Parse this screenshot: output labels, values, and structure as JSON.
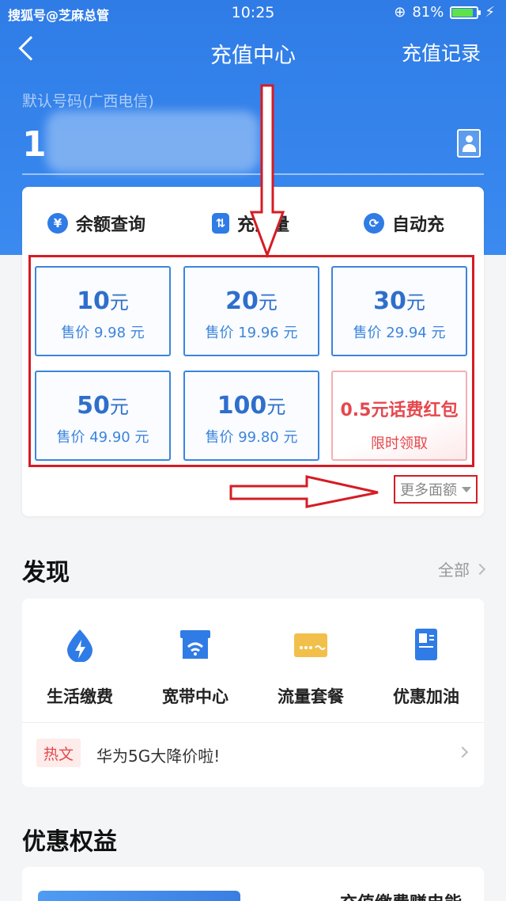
{
  "status_bar": {
    "watermark": "搜狐号@芝麻总管",
    "time": "10:25",
    "battery": "81%",
    "battery_level": 0.81
  },
  "nav": {
    "title": "充值中心",
    "records_label": "充值记录"
  },
  "phone": {
    "label": "默认号码(广西电信)",
    "number_visible": "1"
  },
  "quick_actions": [
    {
      "label": "余额查询",
      "icon": "yuan-search-icon"
    },
    {
      "label": "充流量",
      "icon": "data-flow-icon"
    },
    {
      "label": "自动充",
      "icon": "refresh-icon"
    }
  ],
  "tiles": [
    {
      "amount": "10",
      "unit": "元",
      "price": "售价 9.98 元"
    },
    {
      "amount": "20",
      "unit": "元",
      "price": "售价 19.96 元"
    },
    {
      "amount": "30",
      "unit": "元",
      "price": "售价 29.94 元"
    },
    {
      "amount": "50",
      "unit": "元",
      "price": "售价 49.90 元"
    },
    {
      "amount": "100",
      "unit": "元",
      "price": "售价 99.80 元"
    }
  ],
  "promo_tile": {
    "title": "0.5元话费红包",
    "subtitle": "限时领取"
  },
  "more_amounts_label": "更多面额",
  "discover": {
    "title": "发现",
    "see_all": "全部",
    "items": [
      {
        "label": "生活缴费",
        "icon": "water-drop-icon"
      },
      {
        "label": "宽带中心",
        "icon": "wifi-store-icon"
      },
      {
        "label": "流量套餐",
        "icon": "card-icon"
      },
      {
        "label": "优惠加油",
        "icon": "fuel-pump-icon"
      }
    ],
    "hot_tag": "热文",
    "hot_text": "华为5G大降价啦!"
  },
  "benefits": {
    "title": "优惠权益",
    "item_text": "充值缴费赚电能"
  },
  "colors": {
    "primary_blue": "#2f7ce6",
    "annotation_red": "#d61c24",
    "promo_red": "#e5484d"
  }
}
